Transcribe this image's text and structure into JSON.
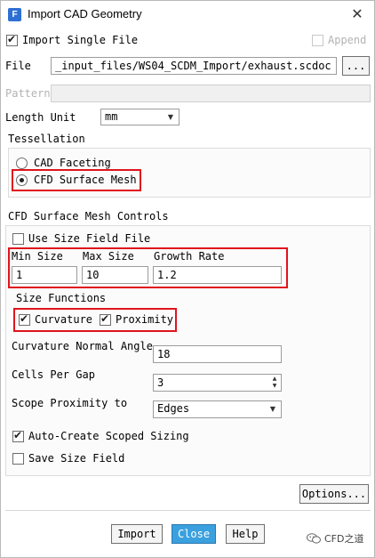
{
  "window": {
    "title": "Import CAD Geometry",
    "app_icon_letter": "F"
  },
  "import_single_file": {
    "label": "Import Single File",
    "checked": true
  },
  "append": {
    "label": "Append",
    "checked": false,
    "enabled": false
  },
  "file": {
    "label": "File",
    "value": "_input_files/WS04_SCDM_Import/exhaust.scdoc",
    "browse_label": "..."
  },
  "pattern": {
    "label": "Pattern",
    "value": ""
  },
  "length_unit": {
    "label": "Length Unit",
    "value": "mm"
  },
  "tessellation": {
    "title": "Tessellation",
    "options": [
      {
        "label": "CAD Faceting",
        "selected": false
      },
      {
        "label": "CFD Surface Mesh",
        "selected": true
      }
    ]
  },
  "controls": {
    "title": "CFD Surface Mesh Controls",
    "use_size_field_file": {
      "label": "Use Size Field File",
      "checked": false
    },
    "min_size": {
      "label": "Min Size",
      "value": "1"
    },
    "max_size": {
      "label": "Max Size",
      "value": "10"
    },
    "growth_rate": {
      "label": "Growth Rate",
      "value": "1.2"
    },
    "size_functions": {
      "title": "Size Functions",
      "curvature": {
        "label": "Curvature",
        "checked": true
      },
      "proximity": {
        "label": "Proximity",
        "checked": true
      }
    },
    "curvature_normal_angle": {
      "label": "Curvature Normal Angle",
      "value": "18"
    },
    "cells_per_gap": {
      "label": "Cells Per Gap",
      "value": "3"
    },
    "scope_proximity_to": {
      "label": "Scope Proximity to",
      "value": "Edges"
    },
    "auto_create_scoped_sizing": {
      "label": "Auto-Create Scoped Sizing",
      "checked": true
    },
    "save_size_field": {
      "label": "Save Size Field",
      "checked": false
    }
  },
  "buttons": {
    "options": "Options...",
    "import": "Import",
    "close": "Close",
    "help": "Help"
  },
  "watermark": {
    "text": "CFD之道"
  },
  "colors": {
    "highlight": "#e0141c",
    "primary_button": "#3aa0de"
  }
}
